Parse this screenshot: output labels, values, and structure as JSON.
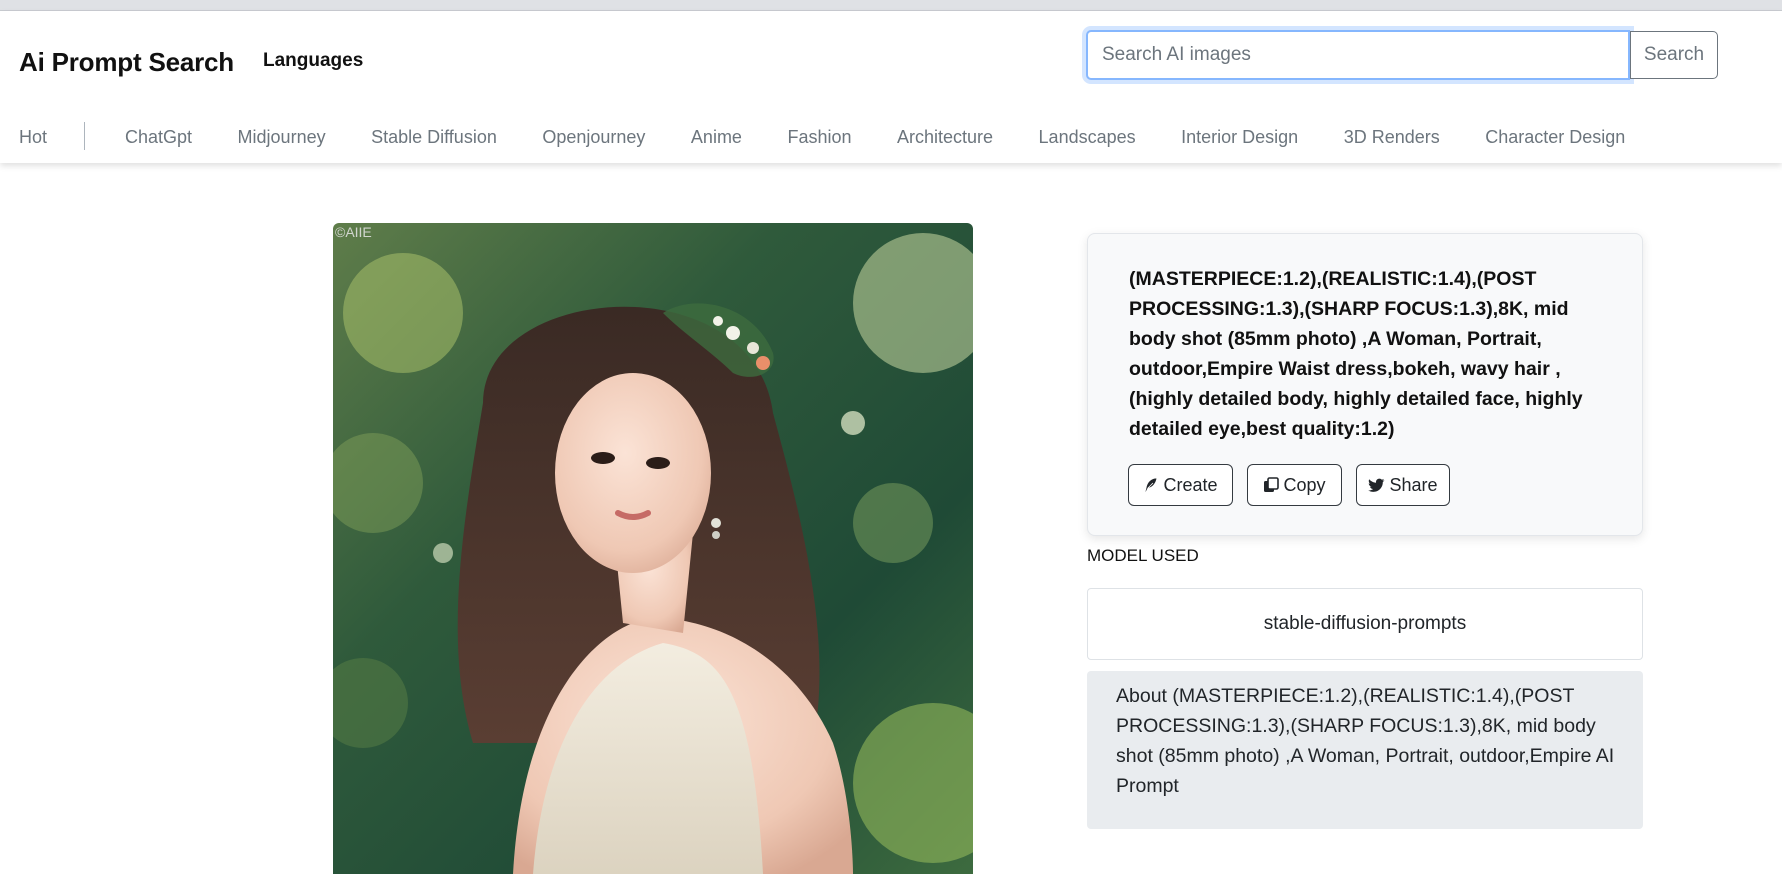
{
  "header": {
    "brand": "Ai Prompt Search",
    "languages_label": "Languages",
    "search": {
      "placeholder": "Search AI images",
      "value": "",
      "button_label": "Search"
    }
  },
  "nav": {
    "hot_label": "Hot",
    "items": [
      "ChatGpt",
      "Midjourney",
      "Stable Diffusion",
      "Openjourney",
      "Anime",
      "Fashion",
      "Architecture",
      "Landscapes",
      "Interior Design",
      "3D Renders",
      "Character Design"
    ]
  },
  "image": {
    "watermark": "©AIIE"
  },
  "prompt": {
    "text": "(MASTERPIECE:1.2),(REALISTIC:1.4),(POST PROCESSING:1.3),(SHARP FOCUS:1.3),8K, mid body shot (85mm photo) ,A Woman, Portrait, outdoor,Empire Waist dress,bokeh, wavy hair ,(highly detailed body, highly detailed face, highly detailed eye,best quality:1.2)",
    "actions": {
      "create": {
        "label": "Create",
        "icon": "feather-icon"
      },
      "copy": {
        "label": "Copy",
        "icon": "copy-icon"
      },
      "share": {
        "label": "Share",
        "icon": "twitter-icon"
      }
    }
  },
  "model": {
    "label": "MODEL USED",
    "name": "stable-diffusion-prompts"
  },
  "about": {
    "text": "About (MASTERPIECE:1.2),(REALISTIC:1.4),(POST PROCESSING:1.3),(SHARP FOCUS:1.3),8K, mid body shot (85mm photo) ,A Woman, Portrait, outdoor,Empire AI Prompt"
  },
  "colors": {
    "focus_ring": "#86b7fe",
    "muted_text": "#6c757d",
    "card_bg": "#f8f9fa",
    "about_bg": "#e9ecef"
  }
}
